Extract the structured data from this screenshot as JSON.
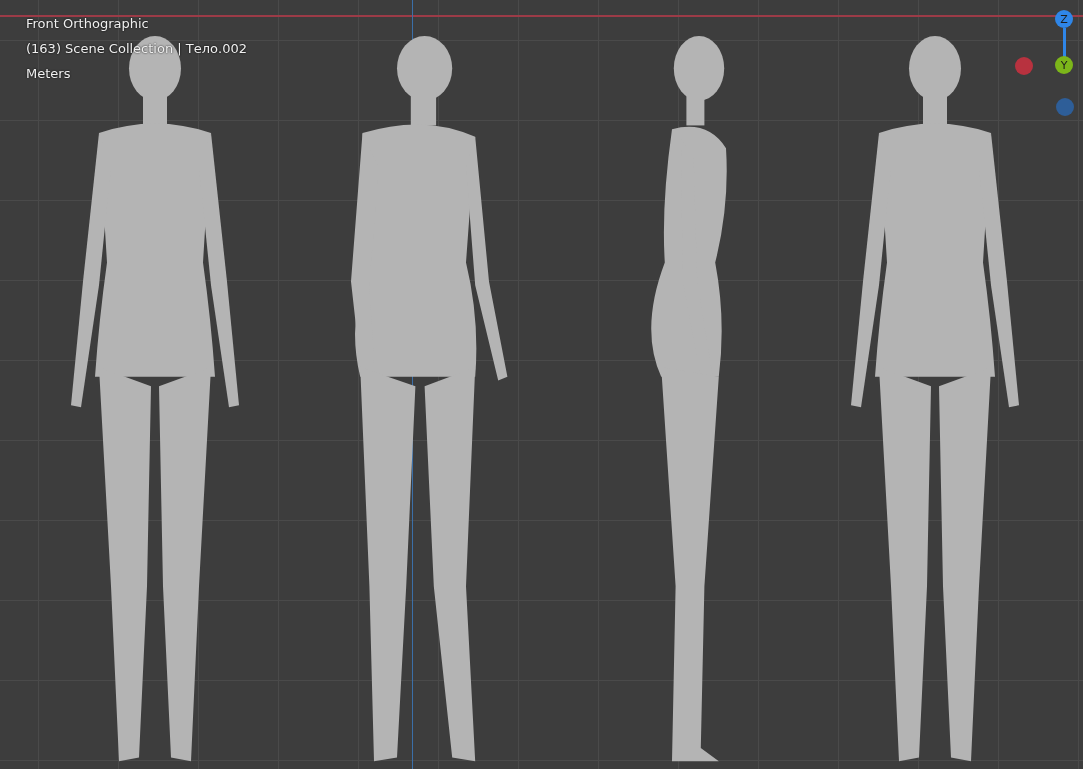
{
  "viewport": {
    "overlay": [
      "Front Orthographic",
      "(163) Scene Collection | Тело.002",
      "Meters"
    ],
    "figures": [
      {
        "kind": "front"
      },
      {
        "kind": "three-quarter"
      },
      {
        "kind": "side"
      },
      {
        "kind": "back"
      }
    ],
    "gizmo": [
      {
        "kind": "labeled",
        "label": "Z",
        "color": "#2f86e8"
      },
      {
        "kind": "labeled",
        "label": "Y",
        "color": "#7cb61a"
      },
      {
        "kind": "dot",
        "color": "#b8323f"
      },
      {
        "kind": "dot",
        "color": "#2e5e98"
      }
    ]
  }
}
